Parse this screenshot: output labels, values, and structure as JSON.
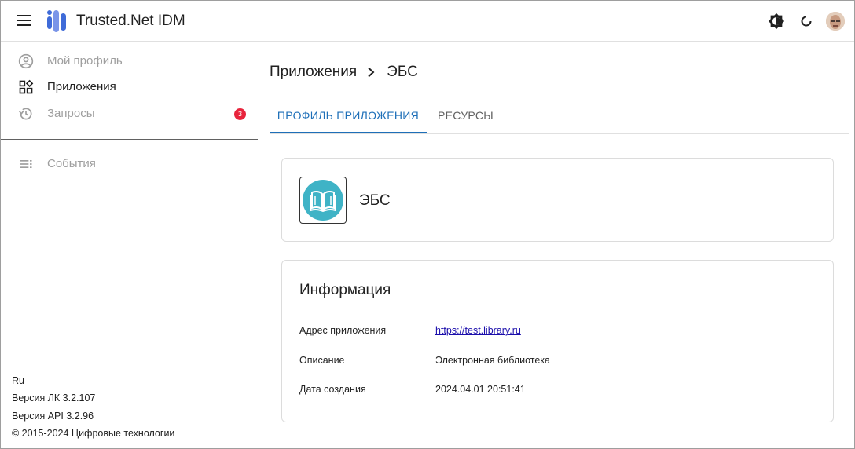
{
  "header": {
    "title": "Trusted.Net IDM",
    "menu_icon": "hamburger-menu-icon",
    "theme_icon": "brightness-theme-icon",
    "refresh_icon": "refresh-icon",
    "avatar": "user-avatar"
  },
  "sidebar": {
    "items": [
      {
        "label": "Мой профиль",
        "icon": "account-circle-icon"
      },
      {
        "label": "Приложения",
        "icon": "apps-widgets-icon"
      },
      {
        "label": "Запросы",
        "icon": "history-icon",
        "badge": "3"
      },
      {
        "label": "События",
        "icon": "list-lines-icon"
      }
    ],
    "footer": {
      "language": "Ru",
      "version_lk": "Версия ЛК 3.2.107",
      "version_api": "Версия API 3.2.96",
      "copyright": "© 2015-2024 Цифровые технологии"
    }
  },
  "breadcrumb": {
    "parent": "Приложения",
    "current": "ЭБС"
  },
  "tabs": [
    {
      "label": "ПРОФИЛЬ ПРИЛОЖЕНИЯ",
      "active": true
    },
    {
      "label": "РЕСУРСЫ",
      "active": false
    }
  ],
  "app_card": {
    "name": "ЭБС",
    "logo_icon": "open-book-icon"
  },
  "info": {
    "title": "Информация",
    "rows": [
      {
        "key": "Адрес приложения",
        "value": "https://test.library.ru"
      },
      {
        "key": "Описание",
        "value": "Электронная библиотека"
      },
      {
        "key": "Дата создания",
        "value": "2024.04.01 20:51:41"
      }
    ]
  },
  "colors": {
    "accent": "#1e6fb8",
    "badge": "#e8243c",
    "logo_circle": "#3fb3c6",
    "brand_blue": "#3f6bd8"
  }
}
